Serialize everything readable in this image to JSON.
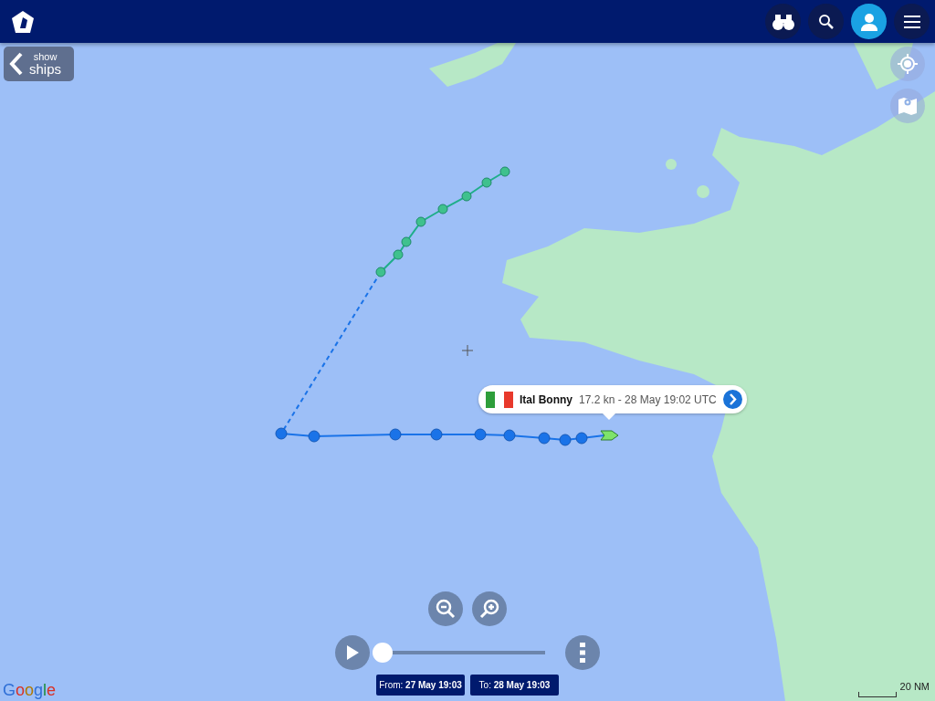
{
  "side_button": {
    "line_1": "show",
    "line_2": "ships"
  },
  "vessel_popup": {
    "name": "Ital Bonny",
    "details": "17.2 kn - 28 May 19:02 UTC"
  },
  "playback": {
    "level": 0,
    "from_label": "From:",
    "from_value": "27 May 19:03",
    "to_label": "To:",
    "to_value": "28 May 19:03"
  },
  "scale": "20 NM",
  "attribution": "Google"
}
